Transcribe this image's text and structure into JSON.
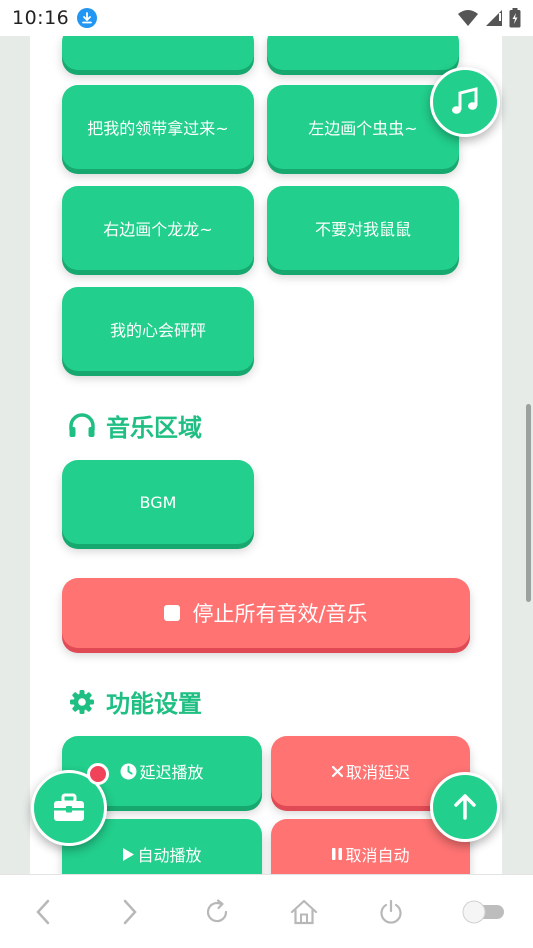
{
  "status_bar": {
    "time": "10:16"
  },
  "sound_buttons": [
    {
      "label": ""
    },
    {
      "label": ""
    },
    {
      "label": "把我的领带拿过来~"
    },
    {
      "label": "左边画个虫虫~"
    },
    {
      "label": "右边画个龙龙~"
    },
    {
      "label": "不要对我鼠鼠"
    },
    {
      "label": "我的心会砰砰"
    }
  ],
  "music_section": {
    "title": "音乐区域",
    "bgm_label": "BGM",
    "stop_label": "停止所有音效/音乐"
  },
  "settings_section": {
    "title": "功能设置",
    "delay_play": "延迟播放",
    "cancel_delay": "取消延迟",
    "auto_play": "自动播放",
    "cancel_auto": "取消自动"
  },
  "colors": {
    "accent": "#22cf8c",
    "danger": "#ff7373",
    "badge": "#f0435a"
  },
  "icons": [
    "download-icon",
    "wifi-icon",
    "signal-icon",
    "battery-icon",
    "music-note-icon",
    "headphones-icon",
    "stop-icon",
    "gear-icon",
    "clock-icon",
    "close-icon",
    "play-icon",
    "pause-icon",
    "toolbox-icon",
    "arrow-up-icon",
    "back-icon",
    "forward-icon",
    "reload-icon",
    "home-icon",
    "power-icon",
    "toggle-icon"
  ]
}
